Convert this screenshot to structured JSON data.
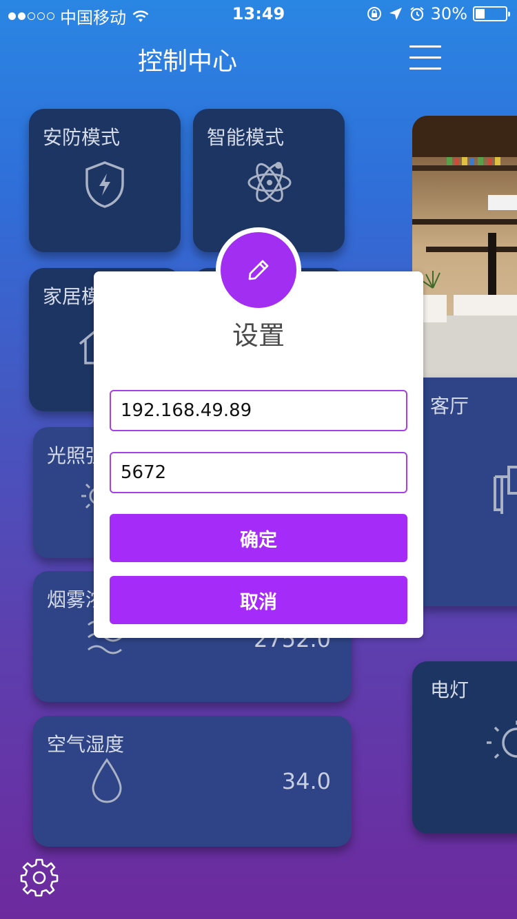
{
  "status_bar": {
    "carrier": "中国移动",
    "time": "13:49",
    "battery_text": "30%"
  },
  "header": {
    "title": "控制中心"
  },
  "tiles": {
    "security_mode": {
      "label": "安防模式",
      "icon": "shield-bolt-icon"
    },
    "smart_mode": {
      "label": "智能模式",
      "icon": "atom-icon"
    },
    "home_mode": {
      "label": "家居模",
      "icon": "house-icon"
    },
    "light": {
      "label": "光照强",
      "icon": "sun-icon"
    },
    "smoke": {
      "label": "烟雾浓",
      "value": "2752.0",
      "icon": "waves-icon"
    },
    "humidity": {
      "label": "空气湿度",
      "value": "34.0",
      "icon": "drop-icon"
    },
    "living_room": {
      "label": "客厅",
      "icon": "door-icon"
    },
    "lamp": {
      "label": "电灯",
      "icon": "bulb-icon"
    }
  },
  "dialog": {
    "title": "设置",
    "ip_value": "192.168.49.89",
    "port_value": "5672",
    "confirm_label": "确定",
    "cancel_label": "取消",
    "icon": "pencil-icon"
  },
  "footer": {
    "icon": "gear-icon"
  },
  "colors": {
    "accent": "#a42bf8",
    "tile_dark": "#1c3563",
    "tile_mid": "#2e4486"
  }
}
